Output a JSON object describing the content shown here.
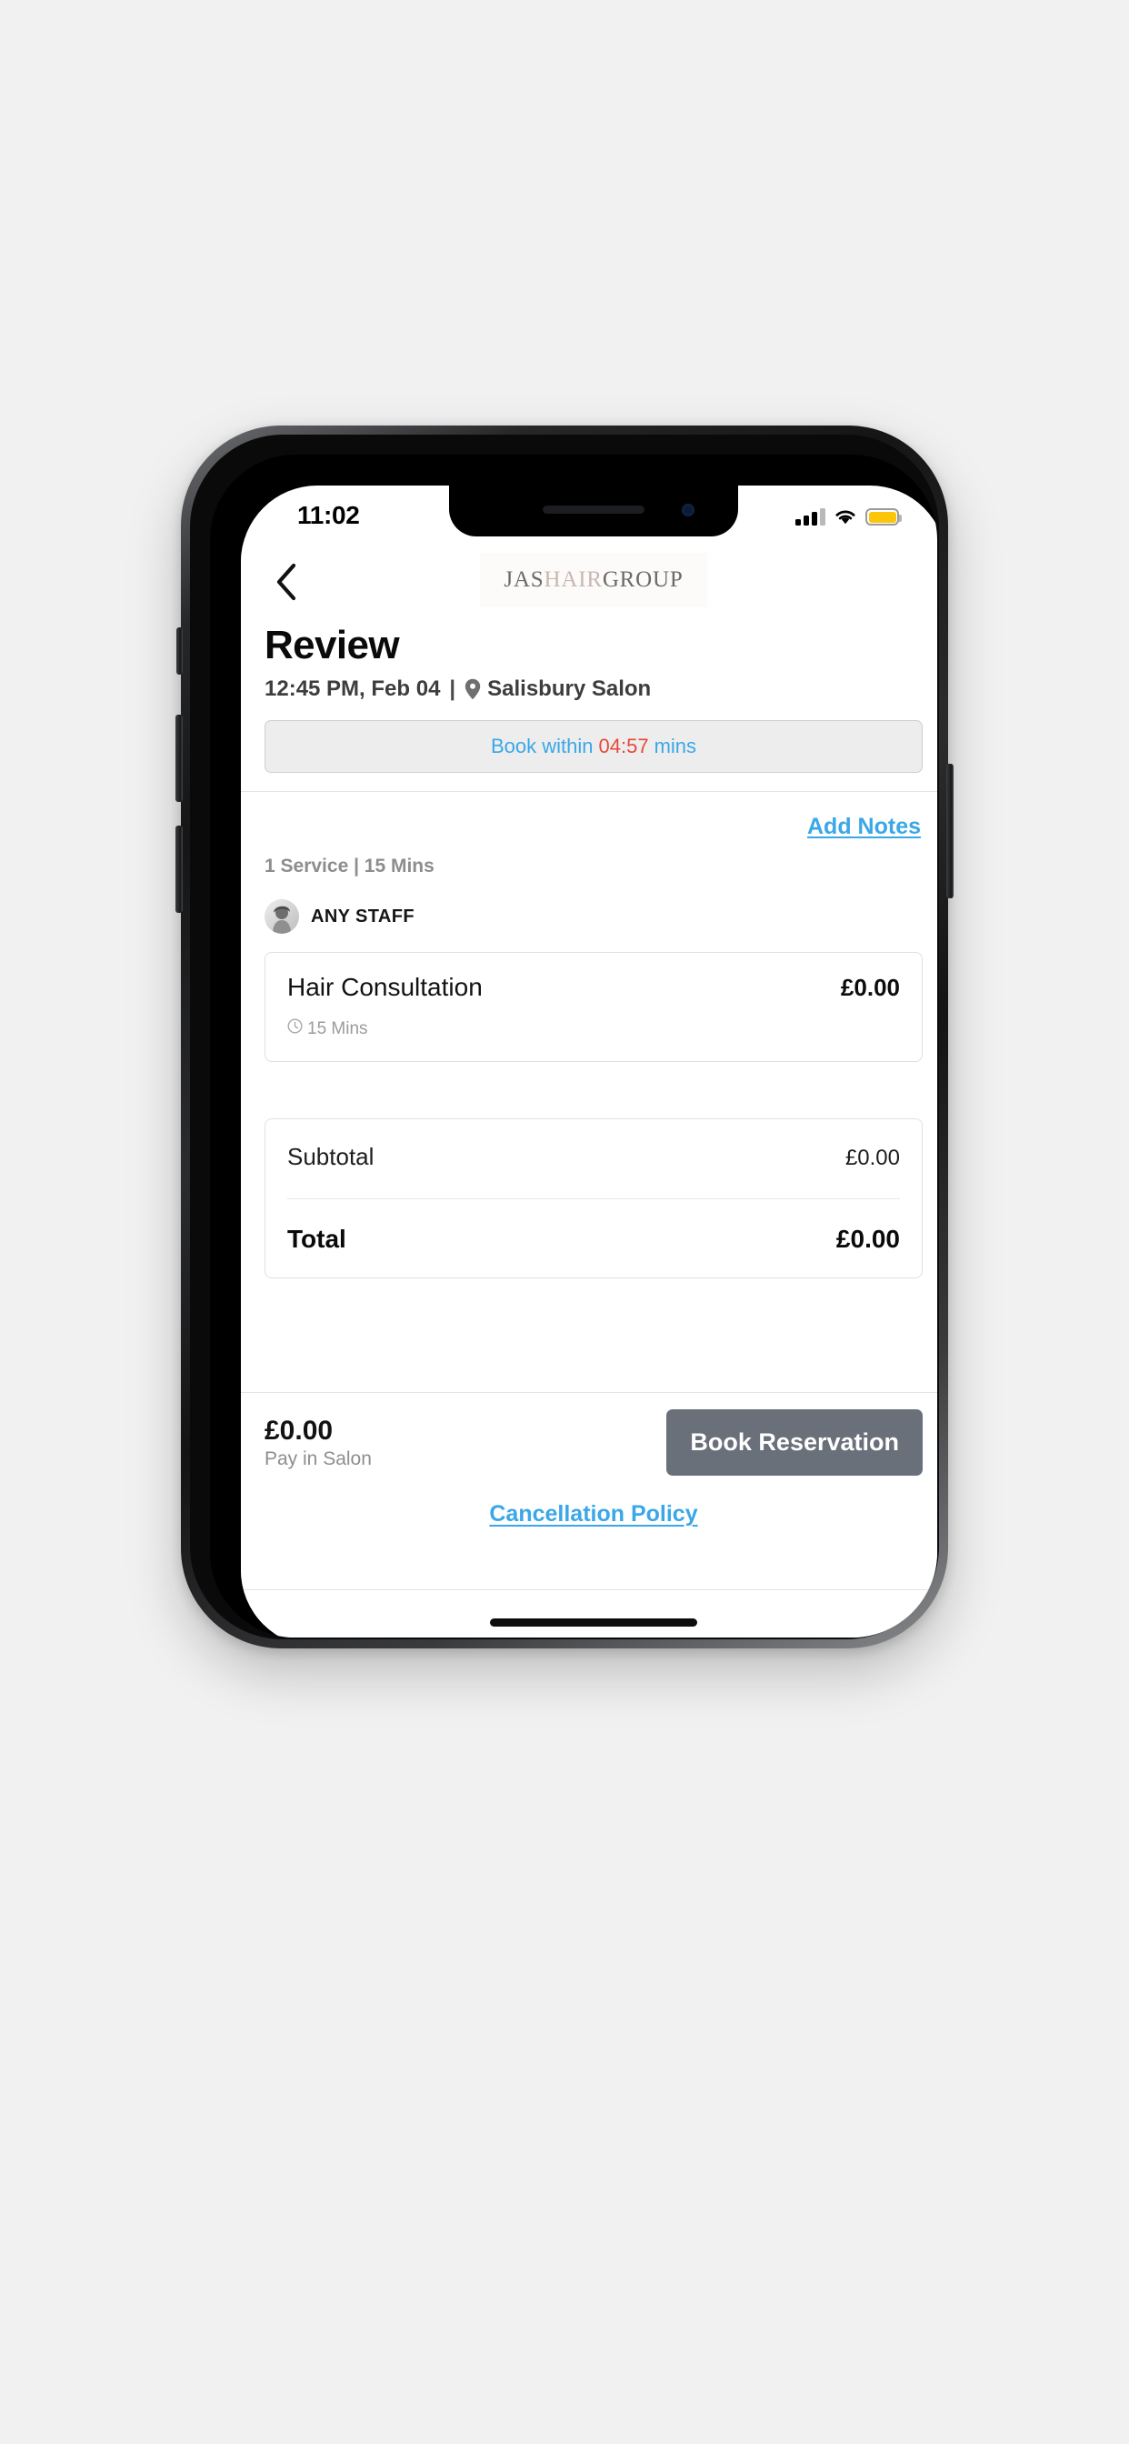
{
  "status_bar": {
    "time": "11:02",
    "signal_icon": "cellular-bars-icon",
    "wifi_icon": "wifi-icon",
    "battery_icon": "battery-icon",
    "battery_color": "#fcc508"
  },
  "nav": {
    "back_icon": "chevron-left-icon",
    "logo": {
      "part1": "JAS",
      "part2": "HAIR",
      "part3": "GROUP",
      "part1_color": "#6c6a68",
      "part2_color": "#c9b7b1",
      "part3_color": "#6c6a68"
    }
  },
  "header": {
    "title": "Review",
    "datetime": "12:45 PM, Feb 04",
    "separator": "|",
    "pin_icon": "location-pin-icon",
    "location": "Salisbury Salon",
    "countdown": {
      "prefix": "Book within",
      "time": "04:57",
      "suffix": "mins",
      "prefix_color": "#3aa7e8",
      "time_color": "#e8483a"
    }
  },
  "booking": {
    "add_notes_label": "Add Notes",
    "service_meta": "1 Service | 15 Mins",
    "staff": {
      "avatar_icon": "staff-avatar-icon",
      "name": "ANY STAFF"
    },
    "services": [
      {
        "name": "Hair Consultation",
        "price": "£0.00",
        "clock_icon": "clock-icon",
        "duration": "15 Mins"
      }
    ],
    "totals": {
      "subtotal_label": "Subtotal",
      "subtotal_value": "£0.00",
      "total_label": "Total",
      "total_value": "£0.00"
    }
  },
  "footer": {
    "pay_amount": "£0.00",
    "pay_note": "Pay in Salon",
    "book_button_label": "Book Reservation",
    "book_button_color": "#69707a",
    "cancellation_policy_label": "Cancellation Policy",
    "link_color": "#3aa7e8"
  }
}
